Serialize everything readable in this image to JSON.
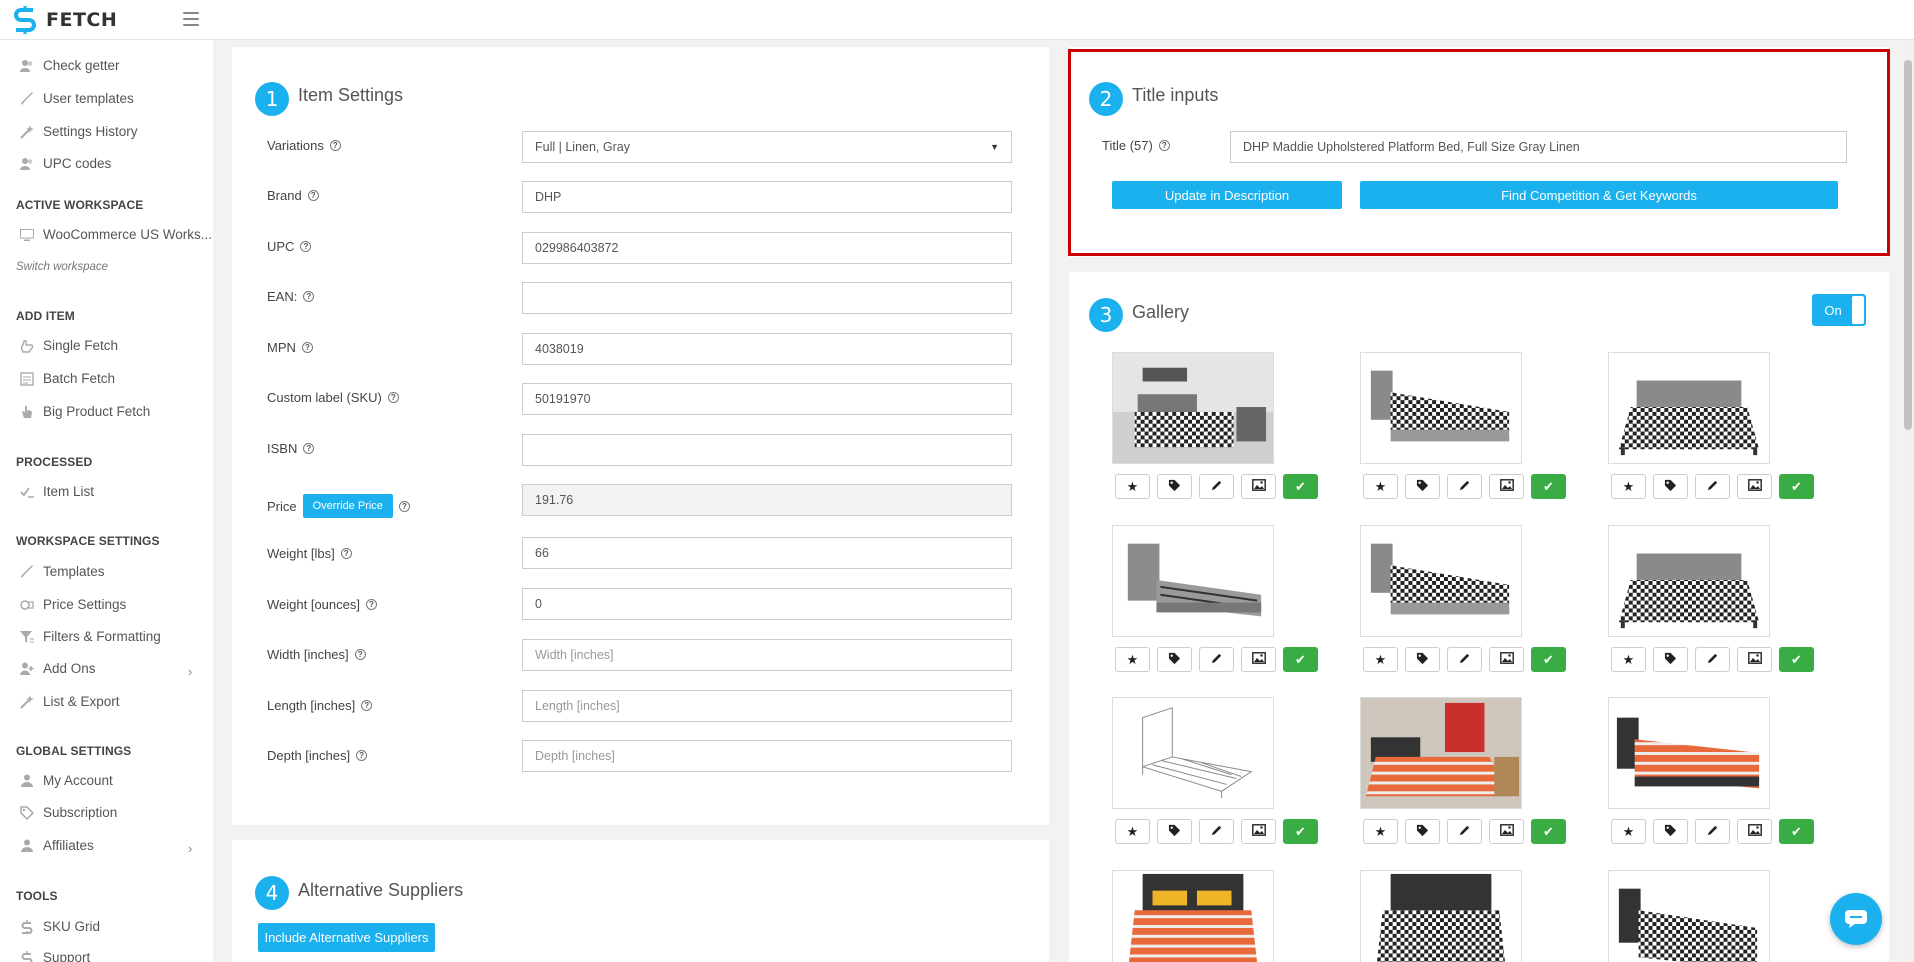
{
  "app": {
    "name": "FETCH"
  },
  "sidebar": {
    "top_items": [
      {
        "label": "Check getter",
        "icon": "users-icon"
      },
      {
        "label": "User templates",
        "icon": "brush-icon"
      },
      {
        "label": "Settings History",
        "icon": "magic-wand-icon"
      },
      {
        "label": "UPC codes",
        "icon": "users-icon"
      }
    ],
    "active_workspace": {
      "heading": "ACTIVE WORKSPACE",
      "item": "WooCommerce US Works...",
      "switch_label": "Switch workspace"
    },
    "add_item": {
      "heading": "ADD ITEM",
      "items": [
        "Single Fetch",
        "Batch Fetch",
        "Big Product Fetch"
      ]
    },
    "processed": {
      "heading": "PROCESSED",
      "items": [
        "Item List"
      ]
    },
    "workspace_settings": {
      "heading": "WORKSPACE SETTINGS",
      "items": [
        "Templates",
        "Price Settings",
        "Filters & Formatting",
        "Add Ons",
        "List & Export"
      ]
    },
    "global_settings": {
      "heading": "GLOBAL SETTINGS",
      "items": [
        "My Account",
        "Subscription",
        "Affiliates"
      ]
    },
    "tools": {
      "heading": "TOOLS",
      "items": [
        "SKU Grid",
        "Support"
      ]
    }
  },
  "item_settings": {
    "step": "1",
    "title": "Item Settings",
    "fields": {
      "variations": {
        "label": "Variations",
        "value": "Full | Linen, Gray"
      },
      "brand": {
        "label": "Brand",
        "value": "DHP"
      },
      "upc": {
        "label": "UPC",
        "value": "029986403872"
      },
      "ean": {
        "label": "EAN:",
        "value": ""
      },
      "mpn": {
        "label": "MPN",
        "value": "4038019"
      },
      "sku": {
        "label": "Custom label (SKU)",
        "value": "50191970"
      },
      "isbn": {
        "label": "ISBN",
        "value": ""
      },
      "price": {
        "label": "Price",
        "button": "Override Price",
        "value": "191.76"
      },
      "weight_lbs": {
        "label": "Weight [lbs]",
        "value": "66"
      },
      "weight_oz": {
        "label": "Weight [ounces]",
        "value": "0"
      },
      "width": {
        "label": "Width [inches]",
        "value": "",
        "placeholder": "Width [inches]"
      },
      "length": {
        "label": "Length [inches]",
        "value": "",
        "placeholder": "Length [inches]"
      },
      "depth": {
        "label": "Depth [inches]",
        "value": "",
        "placeholder": "Depth [inches]"
      }
    }
  },
  "alternative_suppliers": {
    "step": "4",
    "title": "Alternative Suppliers",
    "button": "Include Alternative Suppliers"
  },
  "title_inputs": {
    "step": "2",
    "title": "Title inputs",
    "title_label": "Title (57)",
    "title_value": "DHP Maddie Upholstered Platform Bed, Full Size Gray Linen",
    "update_button": "Update in Description",
    "find_button": "Find Competition & Get Keywords"
  },
  "gallery": {
    "step": "3",
    "title": "Gallery",
    "toggle_label": "On",
    "images": [
      {
        "scene": "room-houndstooth-gray"
      },
      {
        "scene": "houndstooth-gray-side"
      },
      {
        "scene": "houndstooth-gray-front"
      },
      {
        "scene": "bare-gray-frame"
      },
      {
        "scene": "houndstooth-gray-side"
      },
      {
        "scene": "houndstooth-gray-front"
      },
      {
        "scene": "line-drawing"
      },
      {
        "scene": "room-orange-stripes"
      },
      {
        "scene": "orange-stripes-black"
      },
      {
        "scene": "orange-bed-front"
      },
      {
        "scene": "houndstooth-black-front"
      },
      {
        "scene": "houndstooth-black-side"
      }
    ],
    "tool_icons": [
      "star-icon",
      "tag-icon",
      "pencil-icon",
      "image-icon",
      "check-icon"
    ]
  },
  "colors": {
    "accent": "#1ab1ee",
    "success": "#3aac44",
    "highlight": "#cc0000"
  }
}
